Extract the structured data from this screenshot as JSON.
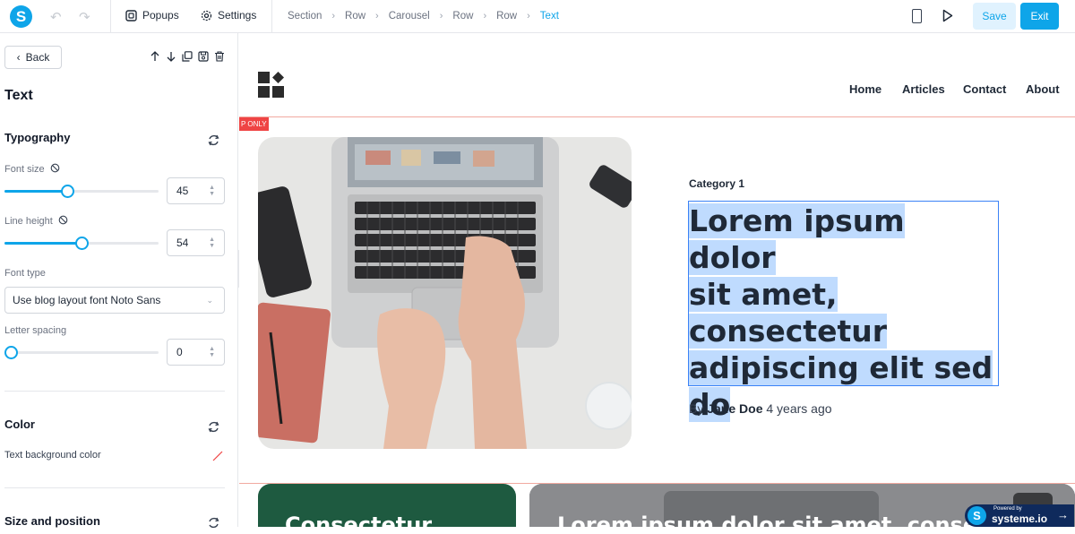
{
  "toolbar": {
    "logo_letter": "S",
    "popups_label": "Popups",
    "settings_label": "Settings",
    "breadcrumbs": [
      "Section",
      "Row",
      "Carousel",
      "Row",
      "Row",
      "Text"
    ],
    "save_label": "Save",
    "exit_label": "Exit"
  },
  "sidebar": {
    "back_label": "Back",
    "panel_title": "Text",
    "typography": {
      "title": "Typography",
      "font_size_label": "Font size",
      "font_size_value": "45",
      "font_size_fraction": 0.4,
      "line_height_label": "Line height",
      "line_height_value": "54",
      "line_height_fraction": 0.5,
      "font_type_label": "Font type",
      "font_type_value": "Use blog layout font Noto Sans",
      "letter_spacing_label": "Letter spacing",
      "letter_spacing_value": "0",
      "letter_spacing_fraction": 0.0
    },
    "color": {
      "title": "Color",
      "text_bg_label": "Text background color"
    },
    "size_position": {
      "title": "Size and position"
    }
  },
  "site": {
    "nav": [
      "Home",
      "Articles",
      "Contact",
      "About"
    ],
    "only_tag": "P ONLY",
    "category": "Category 1",
    "headline_lines": [
      "Lorem ipsum dolor",
      "sit amet,",
      "consectetur",
      "adipiscing elit sed",
      "do"
    ],
    "byline_prefix": "By",
    "byline_author": "Jane Doe",
    "byline_time": "4 years ago",
    "card1_title": "Consectetur",
    "card2_title": "Lorem ipsum dolor sit amet, consectetur"
  },
  "powered": {
    "small": "Powered by",
    "brand": "systeme.io"
  },
  "colors": {
    "accent": "#0ea5e9",
    "card_green": "#1e5a40",
    "selection_border": "#3b82f6",
    "selection_fill": "#bfdbfe",
    "red_guide": "#f1a9a0"
  }
}
